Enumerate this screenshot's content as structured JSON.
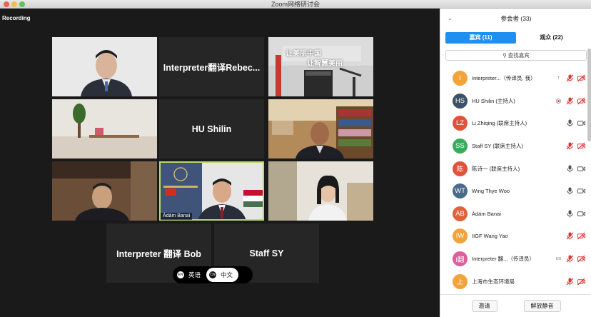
{
  "window": {
    "title": "Zoom网络研讨会"
  },
  "stage": {
    "recording": "Recording",
    "tiles": [
      {
        "name": "",
        "type": "video"
      },
      {
        "name": "Interpreter翻译Rebec...",
        "type": "name"
      },
      {
        "name": "",
        "type": "video"
      },
      {
        "name": "",
        "type": "video"
      },
      {
        "name": "HU Shilin",
        "type": "name"
      },
      {
        "name": "",
        "type": "video"
      },
      {
        "name": "",
        "type": "video"
      },
      {
        "name": "Ádám Banai",
        "type": "video-active"
      },
      {
        "name": "",
        "type": "video"
      },
      {
        "name": "Interpreter 翻译 Bob",
        "type": "name"
      },
      {
        "name": "Staff SY",
        "type": "name"
      }
    ],
    "banner_text_1": "让美丽中国",
    "banner_text_2": "让智慧美丽"
  },
  "language_bar": {
    "options": [
      {
        "badge": "EN",
        "label": "英语",
        "selected": false
      },
      {
        "badge": "CN",
        "label": "中文",
        "selected": true
      }
    ]
  },
  "panel": {
    "title": "参会者 (33)",
    "tabs": [
      {
        "label": "嘉宾 (11)",
        "active": true
      },
      {
        "label": "观众 (22)",
        "active": false
      }
    ],
    "search_placeholder": "查找嘉宾",
    "participants": [
      {
        "initials": "I",
        "color": "#f2a33a",
        "name": "Interpreter...（传译员, 我）",
        "badge": "T",
        "mic": "muted",
        "video": "off"
      },
      {
        "initials": "HS",
        "color": "#3d5166",
        "name": "HU Shilin (主持人)",
        "badge": "rec",
        "mic": "muted",
        "video": "off"
      },
      {
        "initials": "LZ",
        "color": "#e0533a",
        "name": "Li Zhiqing (联席主持人)",
        "badge": "",
        "mic": "on",
        "video": "on"
      },
      {
        "initials": "SS",
        "color": "#3aaa5c",
        "name": "Staff SY (联席主持人)",
        "badge": "",
        "mic": "muted",
        "video": "off"
      },
      {
        "initials": "陈",
        "color": "#e0533a",
        "name": "陈诗一 (联席主持人)",
        "badge": "",
        "mic": "on",
        "video": "on"
      },
      {
        "initials": "WT",
        "color": "#4a6b8a",
        "name": "Wing Thye Woo",
        "badge": "",
        "mic": "on",
        "video": "on"
      },
      {
        "initials": "ÁB",
        "color": "#e0623a",
        "name": "Ádám Banai",
        "badge": "",
        "mic": "on",
        "video": "on"
      },
      {
        "initials": "IW",
        "color": "#f2a33a",
        "name": "IIGF Wang Yao",
        "badge": "",
        "mic": "muted",
        "video": "off"
      },
      {
        "initials": "I翻",
        "color": "#e05c9a",
        "name": "Interpreter 翻...（传译员）",
        "badge": "EN",
        "mic": "muted",
        "video": "off"
      },
      {
        "initials": "上",
        "color": "#f2a33a",
        "name": "上海市生态环境局",
        "badge": "",
        "mic": "muted",
        "video": "off"
      }
    ],
    "footer": {
      "invite": "邀请",
      "unmute": "解放静音"
    }
  }
}
